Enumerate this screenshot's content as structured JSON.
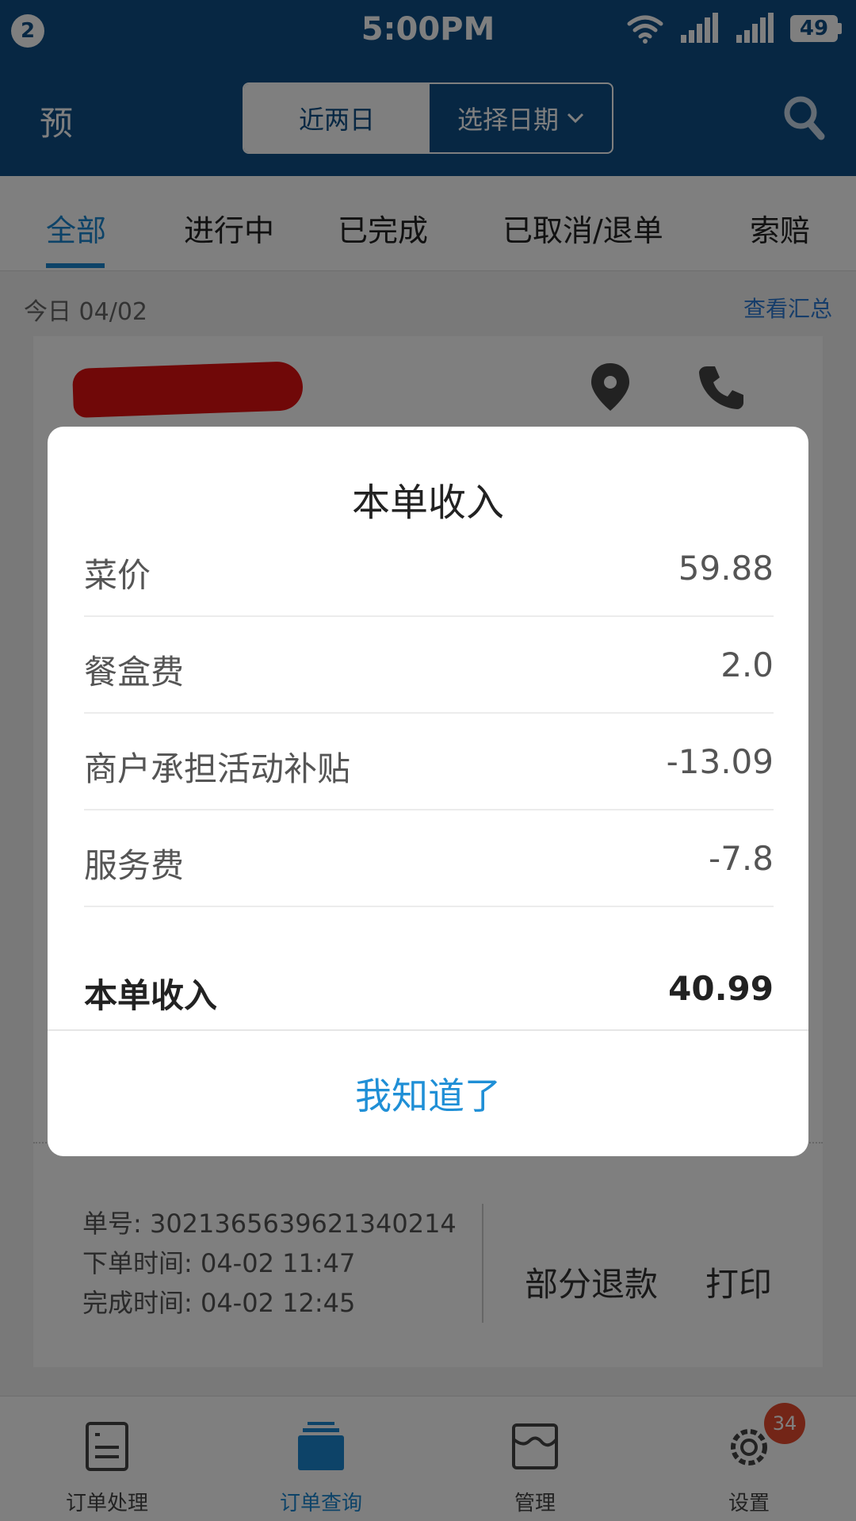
{
  "status_bar": {
    "notification_count": "2",
    "time": "5:00PM",
    "battery": "49",
    "icons": [
      "wifi-icon",
      "signal-sim2-icon",
      "signal-icon"
    ]
  },
  "header": {
    "left_text": "预",
    "date_toggle": {
      "recent": "近两日",
      "pick_date": "选择日期"
    },
    "search_icon": "search-icon"
  },
  "tabs": [
    {
      "label": "全部",
      "active": true
    },
    {
      "label": "进行中"
    },
    {
      "label": "已完成"
    },
    {
      "label": "已取消/退单"
    },
    {
      "label": "索赔"
    }
  ],
  "date_row": {
    "date": "今日 04/02",
    "summary_link": "查看汇总"
  },
  "order": {
    "order_no": "单号: 3021365639621340214",
    "order_time": "下单时间: 04-02 11:47",
    "finish_time": "完成时间: 04-02 12:45",
    "partial_refund": "部分退款",
    "print": "打印",
    "icons": [
      "location-icon",
      "phone-icon"
    ]
  },
  "modal": {
    "title": "本单收入",
    "rows": [
      {
        "label": "菜价",
        "value": "59.88"
      },
      {
        "label": "餐盒费",
        "value": "2.0"
      },
      {
        "label": "商户承担活动补贴",
        "value": "-13.09"
      },
      {
        "label": "服务费",
        "value": "-7.8"
      }
    ],
    "total": {
      "label": "本单收入",
      "value": "40.99"
    },
    "confirm": "我知道了"
  },
  "bottom_nav": [
    {
      "label": "订单处理",
      "icon": "order-process-icon"
    },
    {
      "label": "订单查询",
      "icon": "order-query-icon",
      "active": true
    },
    {
      "label": "管理",
      "icon": "manage-icon"
    },
    {
      "label": "设置",
      "icon": "settings-icon",
      "badge": "34"
    }
  ],
  "colors": {
    "header": "#0f4f86",
    "accent": "#1b86d0",
    "badge": "#e64b2e"
  }
}
